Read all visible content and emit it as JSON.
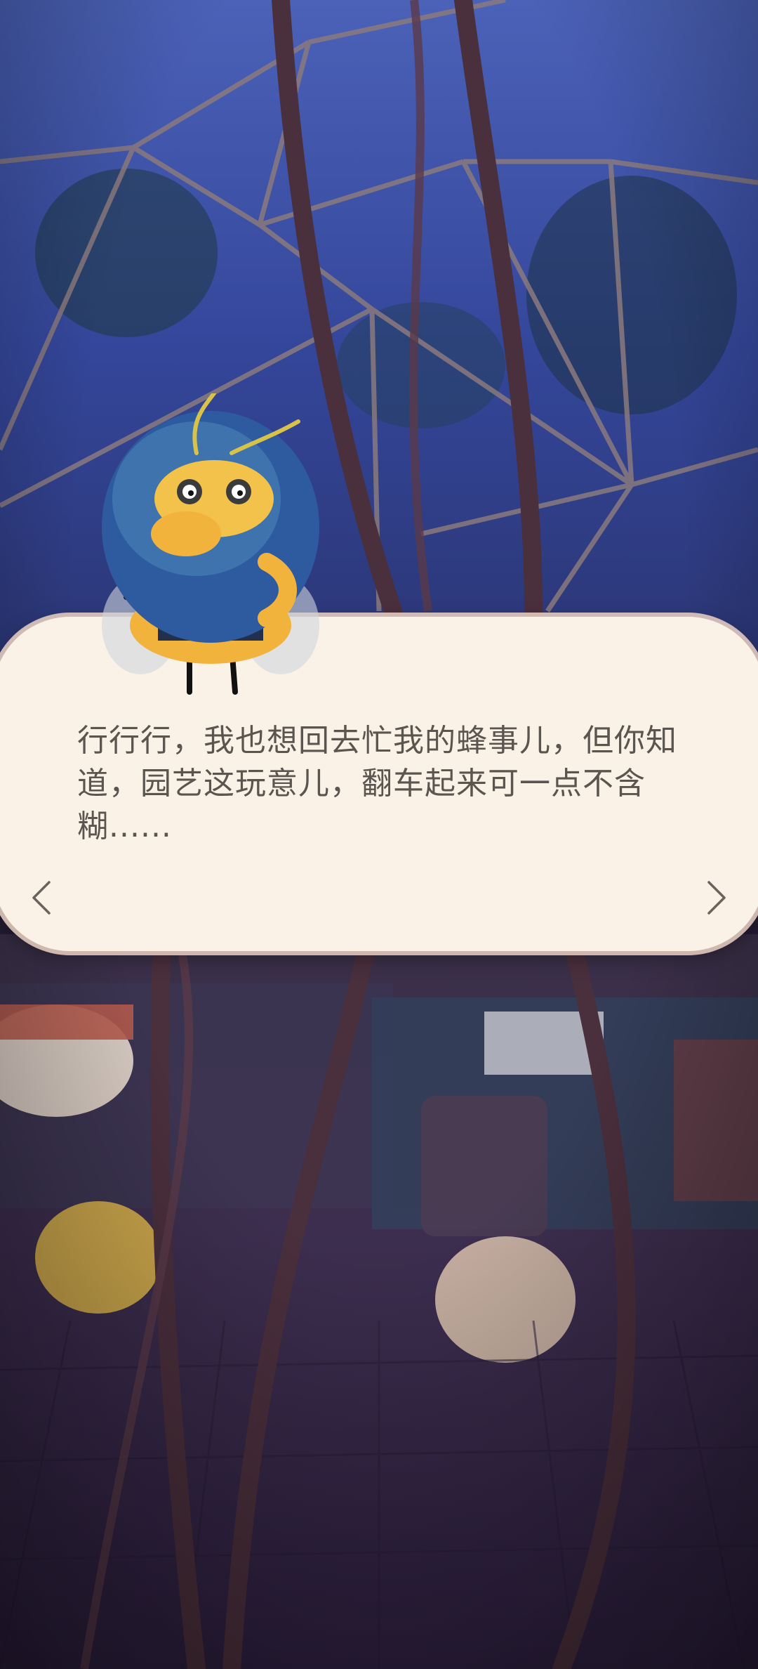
{
  "dialog": {
    "text": "行行行，我也想回去忙我的蜂事儿，但你知道，园艺这玩意儿，翻车起来可一点不含糊......"
  },
  "icons": {
    "prev": "chevron-left-icon",
    "next": "chevron-right-icon"
  },
  "colors": {
    "dialog_bg": "#fbf2e7",
    "dialog_text": "#5b5550",
    "sky": "#3b4f9a",
    "floor": "#3a2b4a"
  }
}
